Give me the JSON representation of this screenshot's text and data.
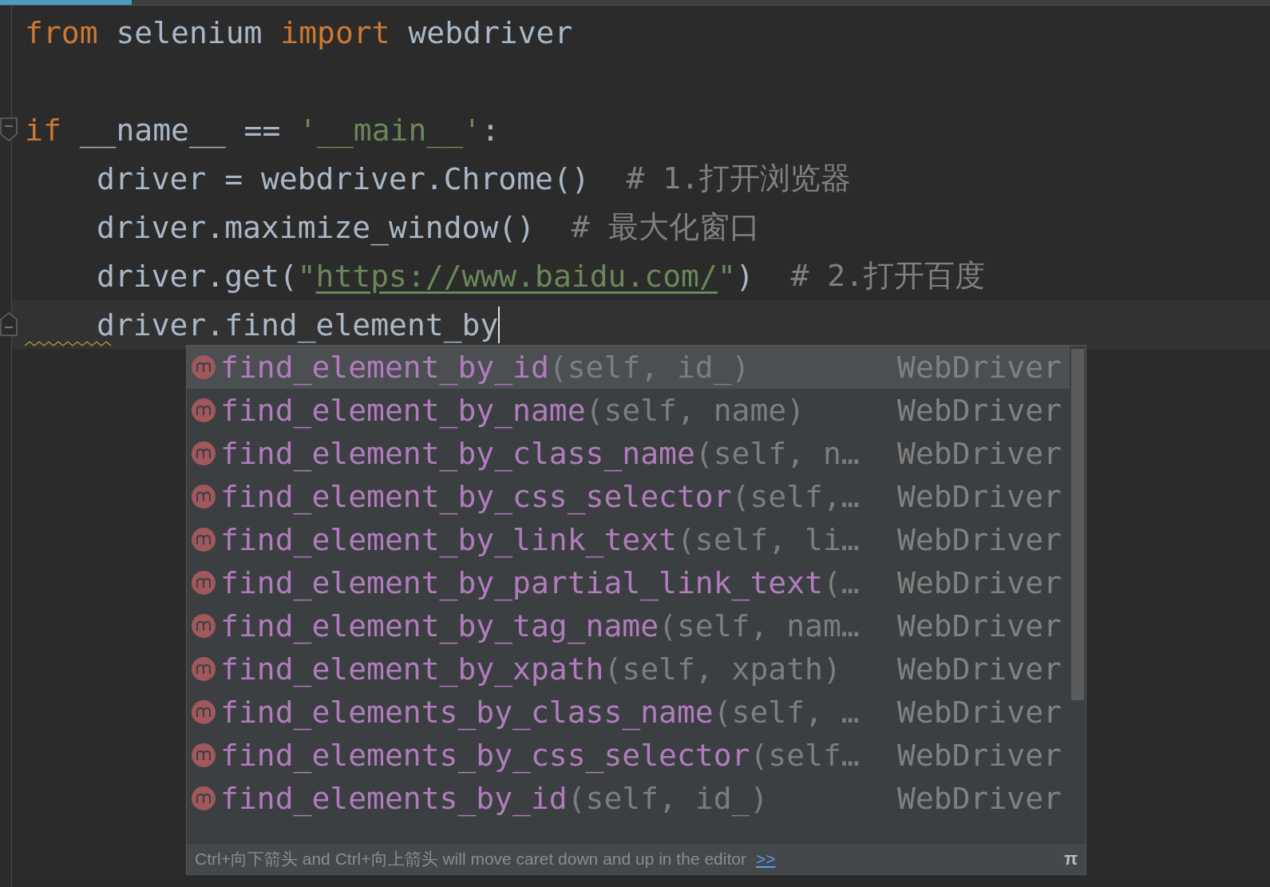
{
  "editor": {
    "lines": [
      {
        "tokens": [
          {
            "kind": "keyword",
            "text": "from"
          },
          {
            "kind": "plain",
            "text": " selenium "
          },
          {
            "kind": "keyword",
            "text": "import"
          },
          {
            "kind": "plain",
            "text": " webdriver"
          }
        ]
      },
      {
        "fold_start": true,
        "tokens": [
          {
            "kind": "keyword",
            "text": "if"
          },
          {
            "kind": "plain",
            "text": " __name__ == "
          },
          {
            "kind": "string",
            "text": "'__main__'"
          },
          {
            "kind": "plain",
            "text": ":"
          }
        ],
        "children": [
          {
            "tokens": [
              {
                "kind": "plain",
                "text": "driver = webdriver.Chrome()  "
              },
              {
                "kind": "comment",
                "text": "# 1.打开浏览器"
              }
            ]
          },
          {
            "tokens": [
              {
                "kind": "plain",
                "text": "driver.maximize_window()  "
              },
              {
                "kind": "comment",
                "text": "# 最大化窗口"
              }
            ]
          },
          {
            "tokens": [
              {
                "kind": "plain",
                "text": "driver.get("
              },
              {
                "kind": "string",
                "text": "\""
              },
              {
                "kind": "url",
                "text": "https://www.baidu.com/"
              },
              {
                "kind": "string",
                "text": "\""
              },
              {
                "kind": "plain",
                "text": ")  "
              },
              {
                "kind": "comment",
                "text": "# 2.打开百度"
              }
            ]
          },
          {
            "fold_end": true,
            "current": true,
            "error": true,
            "caret": true,
            "tokens": [
              {
                "kind": "plain",
                "text": "driver.find_element_by"
              }
            ]
          }
        ]
      }
    ]
  },
  "completion": {
    "items": [
      {
        "name": "find_element_by_id",
        "params": "(self, id_)",
        "type": "WebDriver",
        "selected": true
      },
      {
        "name": "find_element_by_name",
        "params": "(self, name)",
        "type": "WebDriver",
        "selected": false
      },
      {
        "name": "find_element_by_class_name",
        "params": "(self, n…",
        "type": "WebDriver",
        "selected": false
      },
      {
        "name": "find_element_by_css_selector",
        "params": "(self,…",
        "type": "WebDriver",
        "selected": false
      },
      {
        "name": "find_element_by_link_text",
        "params": "(self, li…",
        "type": "WebDriver",
        "selected": false
      },
      {
        "name": "find_element_by_partial_link_text",
        "params": "(…",
        "type": "WebDriver",
        "selected": false
      },
      {
        "name": "find_element_by_tag_name",
        "params": "(self, nam…",
        "type": "WebDriver",
        "selected": false
      },
      {
        "name": "find_element_by_xpath",
        "params": "(self, xpath)",
        "type": "WebDriver",
        "selected": false
      },
      {
        "name": "find_elements_by_class_name",
        "params": "(self, …",
        "type": "WebDriver",
        "selected": false
      },
      {
        "name": "find_elements_by_css_selector",
        "params": "(self…",
        "type": "WebDriver",
        "selected": false
      },
      {
        "name": "find_elements_by_id",
        "params": "(self, id_)",
        "type": "WebDriver",
        "selected": false
      }
    ],
    "hint": "Ctrl+向下箭头 and Ctrl+向上箭头 will move caret down and up in the editor",
    "hint_link": ">>",
    "corner": "π"
  }
}
